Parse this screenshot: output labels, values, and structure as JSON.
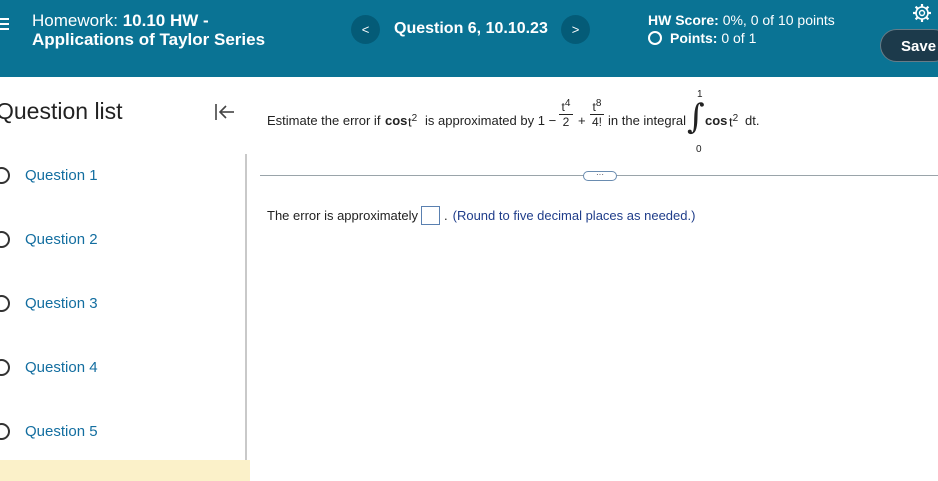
{
  "header": {
    "hw_prefix": "Homework:",
    "hw_number": "10.10 HW -",
    "hw_name": "Applications of Taylor Series",
    "prev_label": "<",
    "next_label": ">",
    "question_label": "Question 6, 10.10.23",
    "hw_score_label": "HW Score:",
    "hw_score_value": "0%, 0 of 10 points",
    "points_label": "Points:",
    "points_value": "0 of 1",
    "save_label": "Save"
  },
  "sidebar": {
    "title": "Question list",
    "questions": [
      {
        "label": "Question 1"
      },
      {
        "label": "Question 2"
      },
      {
        "label": "Question 3"
      },
      {
        "label": "Question 4"
      },
      {
        "label": "Question 5"
      }
    ]
  },
  "problem": {
    "text1": "Estimate the error if",
    "cos_label": "cos",
    "t_var": "t",
    "exp2": "2",
    "text2": "is approximated by 1 −",
    "frac1_num": "t",
    "frac1_num_exp": "4",
    "frac1_den": "2",
    "plus": "+",
    "frac2_num": "t",
    "frac2_num_exp": "8",
    "frac2_den": "4!",
    "text3": "in the integral",
    "upper_limit": "1",
    "lower_limit": "0",
    "integrand_cos": "cos",
    "integrand_t": "t",
    "integrand_exp": "2",
    "dt": "dt."
  },
  "answer": {
    "text_before": "The error is approximately",
    "text_after": ".",
    "hint": "(Round to five decimal places as needed.)",
    "value": ""
  },
  "more_label": "···"
}
